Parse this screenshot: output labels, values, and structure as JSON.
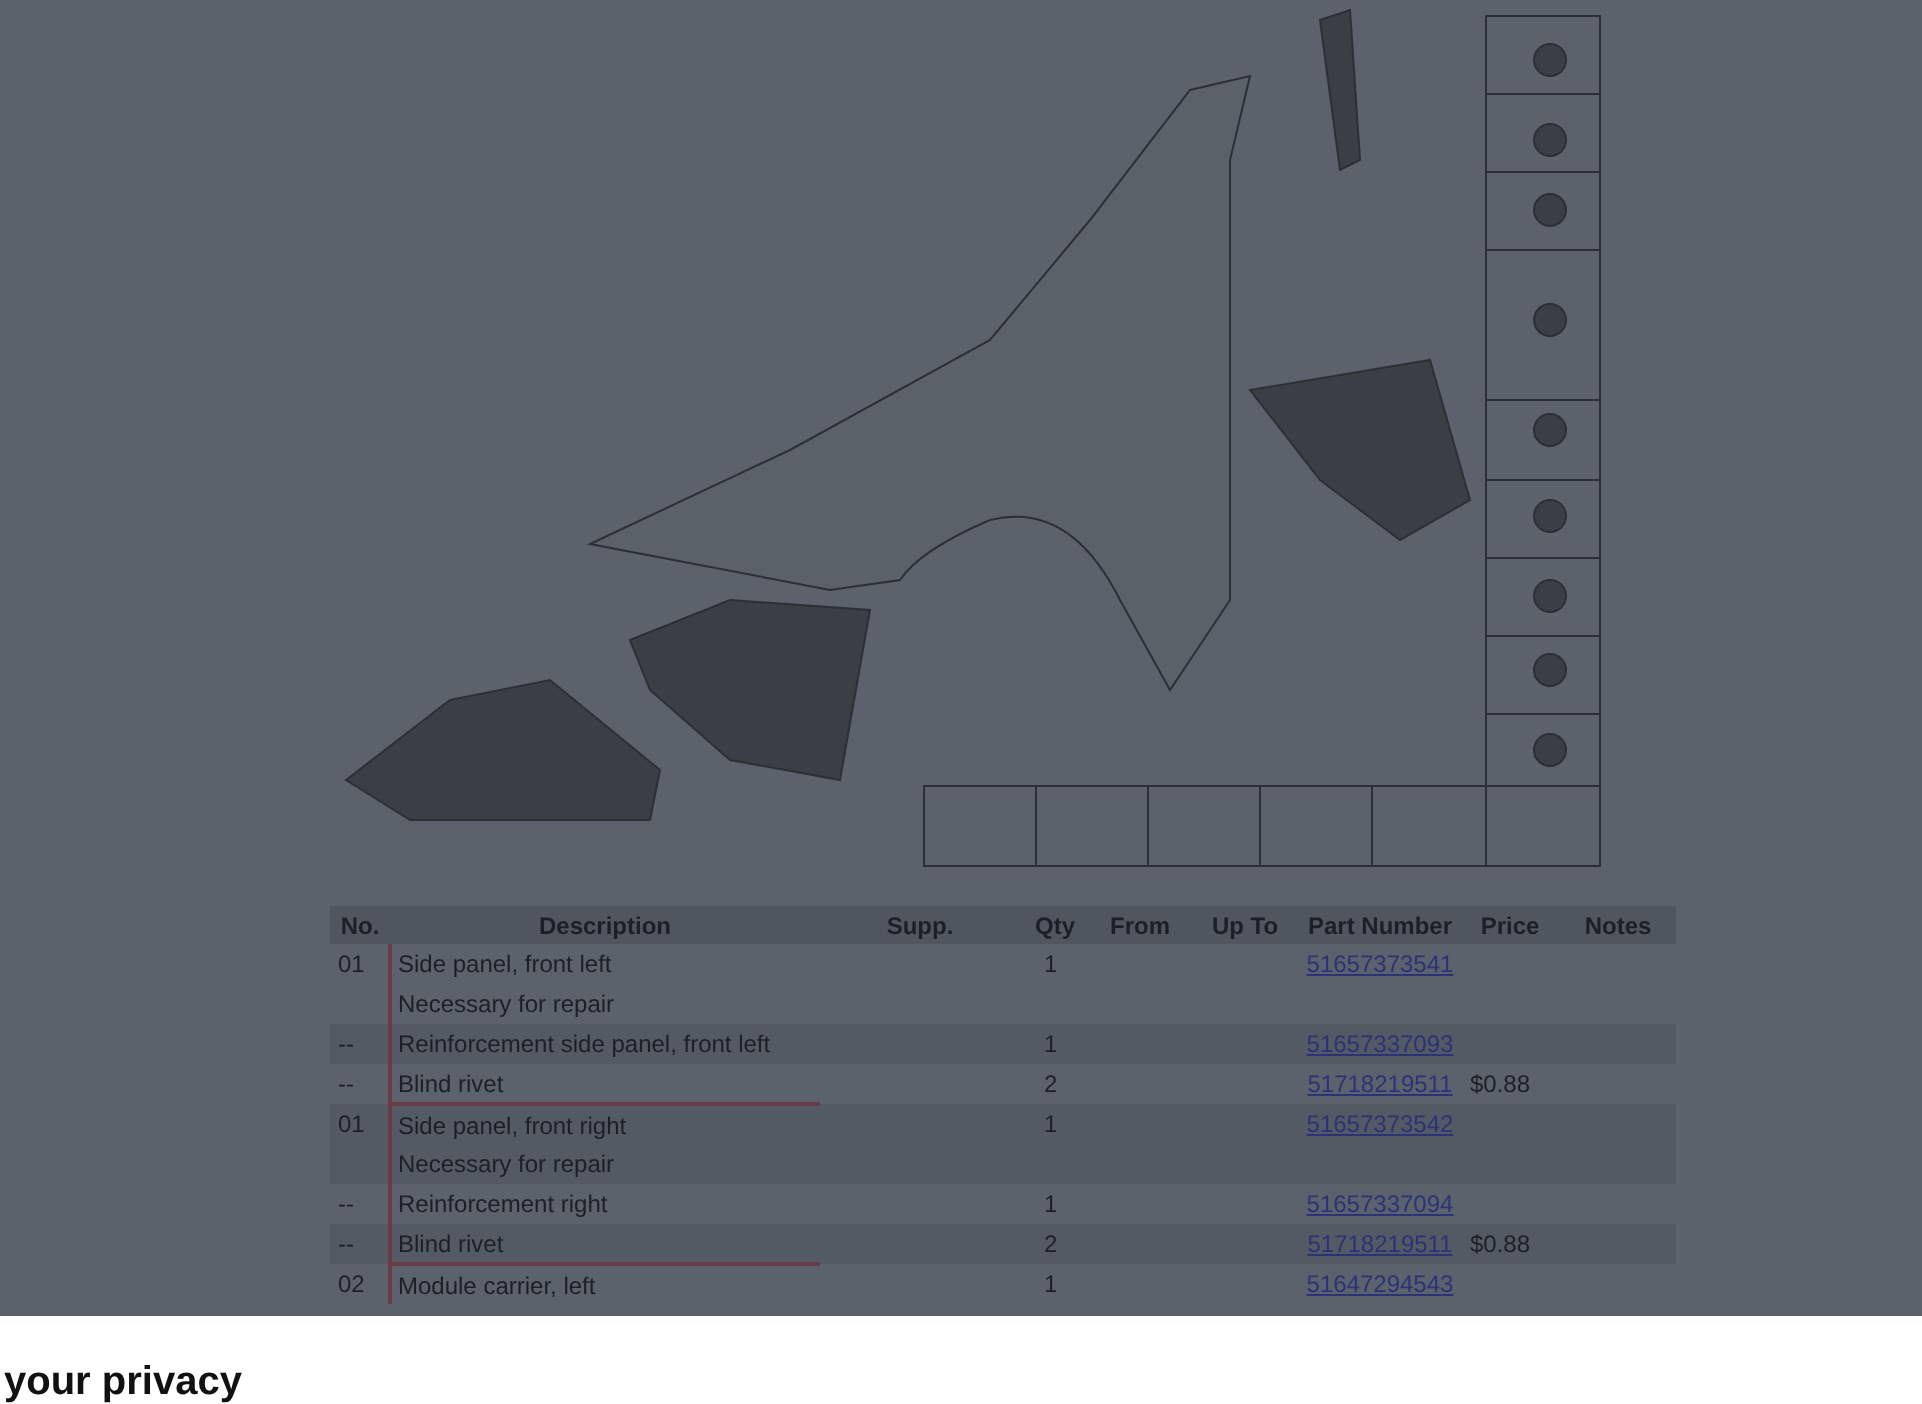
{
  "parts_table": {
    "columns": [
      "No.",
      "Description",
      "Supp.",
      "Qty",
      "From",
      "Up To",
      "Part Number",
      "Price",
      "Notes"
    ],
    "groups": [
      {
        "items": [
          {
            "no": "01",
            "description": "Side panel, front left",
            "note": "Necessary for repair",
            "qty": "1",
            "part_number": "51657373541"
          },
          {
            "no": "--",
            "description": "Reinforcement side panel, front left",
            "qty": "1",
            "part_number": "51657337093"
          },
          {
            "no": "--",
            "description": "Blind rivet",
            "qty": "2",
            "part_number": "51718219511",
            "price": "$0.88"
          }
        ]
      },
      {
        "items": [
          {
            "no": "01",
            "description": "Side panel, front right",
            "note": "Necessary for repair",
            "qty": "1",
            "part_number": "51657373542"
          },
          {
            "no": "--",
            "description": "Reinforcement right",
            "qty": "1",
            "part_number": "51657337094"
          },
          {
            "no": "--",
            "description": "Blind rivet",
            "qty": "2",
            "part_number": "51718219511",
            "price": "$0.88"
          }
        ]
      },
      {
        "items": [
          {
            "no": "02",
            "description": "Module carrier, left",
            "qty": "1",
            "part_number": "51647294543"
          }
        ]
      }
    ]
  },
  "privacy_banner": {
    "title": "your privacy"
  }
}
